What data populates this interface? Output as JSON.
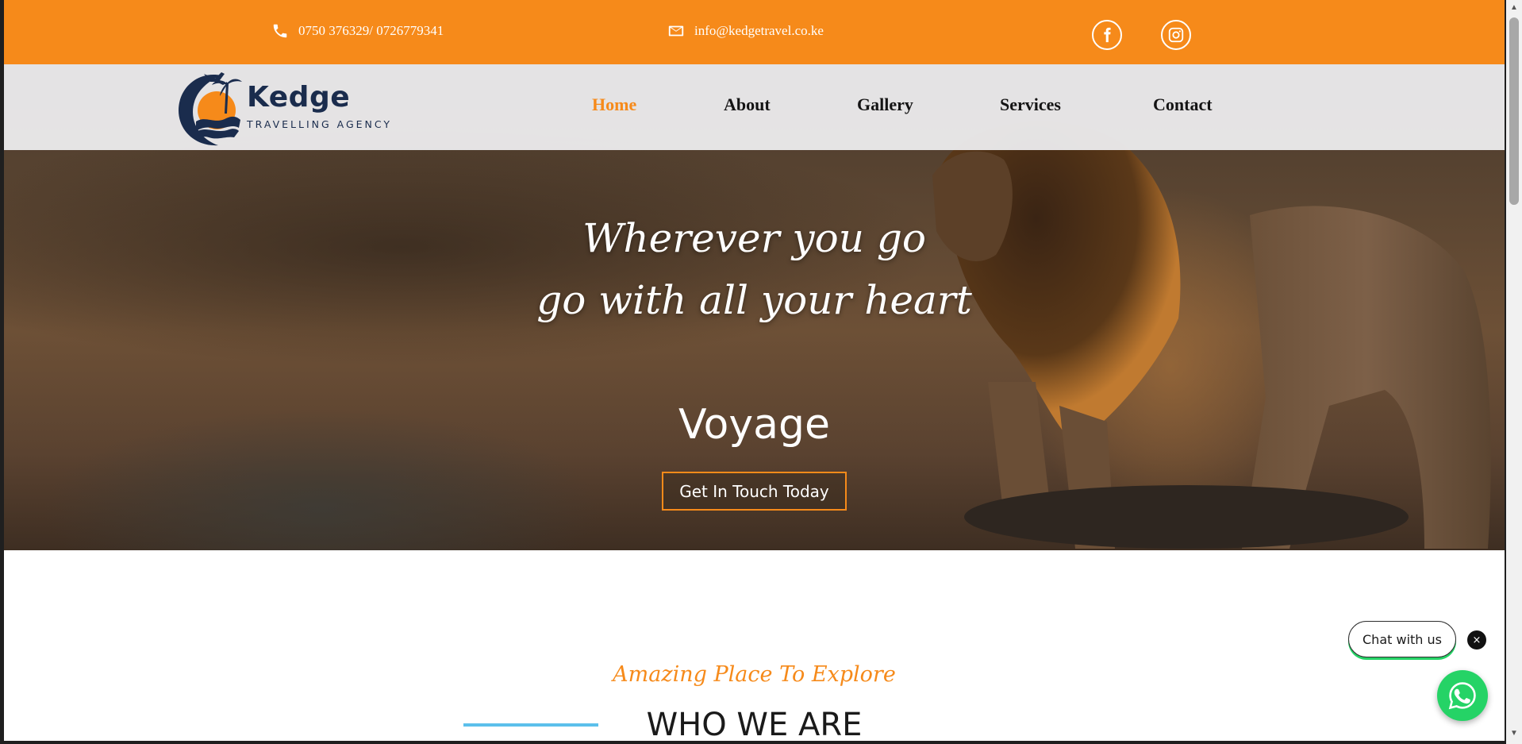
{
  "topbar": {
    "phone": "0750 376329/ 0726779341",
    "email": "info@kedgetravel.co.ke",
    "bg_color": "#f68a1a"
  },
  "social": {
    "facebook_icon": "facebook-icon",
    "instagram_icon": "instagram-icon"
  },
  "logo": {
    "name": "Kedge",
    "tagline": "TRAVELLING AGENCY"
  },
  "nav": {
    "items": [
      {
        "label": "Home",
        "active": true
      },
      {
        "label": "About",
        "active": false
      },
      {
        "label": "Gallery",
        "active": false
      },
      {
        "label": "Services",
        "active": false
      },
      {
        "label": "Contact",
        "active": false
      }
    ],
    "active_color": "#f68a1a"
  },
  "hero": {
    "line1": "Wherever you go",
    "line2": "go with all your heart",
    "title": "Voyage",
    "button": "Get In Touch Today"
  },
  "section": {
    "subtitle": "Amazing Place To Explore",
    "title": "WHO WE ARE",
    "accent_color": "#5bc0eb"
  },
  "chat": {
    "label": "Chat with us",
    "close": "×",
    "whatsapp_icon": "whatsapp-icon",
    "color": "#25d366"
  }
}
